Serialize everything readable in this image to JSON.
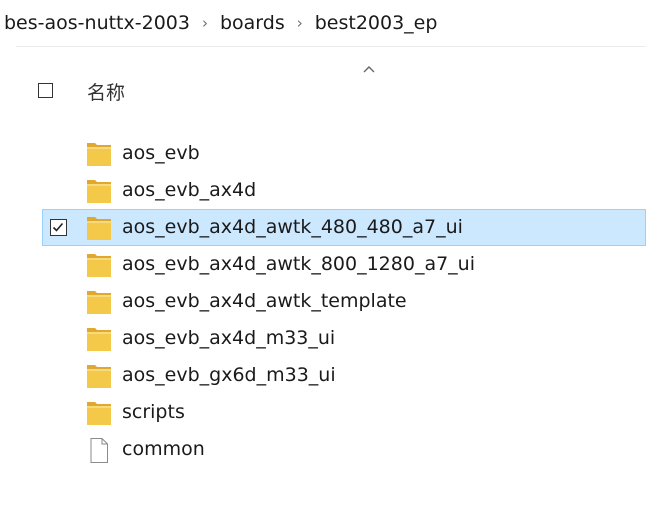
{
  "breadcrumb": {
    "items": [
      "bes-aos-nuttx-2003",
      "boards",
      "best2003_ep"
    ]
  },
  "header": {
    "name_label": "名称"
  },
  "files": [
    {
      "name": "aos_evb",
      "type": "folder",
      "selected": false
    },
    {
      "name": "aos_evb_ax4d",
      "type": "folder",
      "selected": false
    },
    {
      "name": "aos_evb_ax4d_awtk_480_480_a7_ui",
      "type": "folder",
      "selected": true
    },
    {
      "name": "aos_evb_ax4d_awtk_800_1280_a7_ui",
      "type": "folder",
      "selected": false
    },
    {
      "name": "aos_evb_ax4d_awtk_template",
      "type": "folder",
      "selected": false
    },
    {
      "name": "aos_evb_ax4d_m33_ui",
      "type": "folder",
      "selected": false
    },
    {
      "name": "aos_evb_gx6d_m33_ui",
      "type": "folder",
      "selected": false
    },
    {
      "name": "scripts",
      "type": "folder",
      "selected": false
    },
    {
      "name": "common",
      "type": "file",
      "selected": false
    }
  ],
  "colors": {
    "folder": "#f4c94a",
    "selection_bg": "#cce8ff",
    "selection_border": "#99d1ff"
  }
}
